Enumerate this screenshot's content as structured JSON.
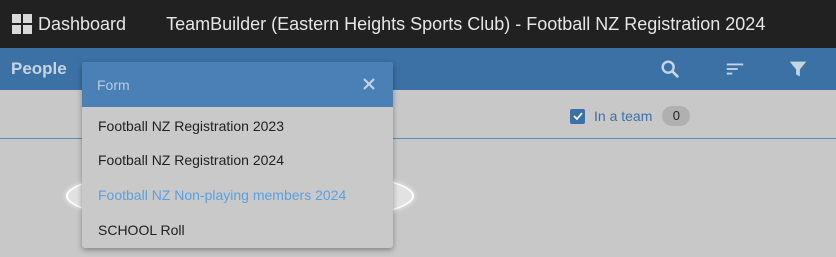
{
  "topbar": {
    "dashboard_label": "Dashboard",
    "app_title": "TeamBuilder (Eastern Heights Sports Club) - Football NZ Registration 2024"
  },
  "toolbar": {
    "section_label": "People",
    "icons": [
      "search-icon",
      "sort-icon",
      "filter-icon"
    ]
  },
  "filters": {
    "in_team_label": "In a team",
    "in_team_checked": true,
    "in_team_count": "0"
  },
  "dropdown": {
    "header_label": "Form",
    "items": [
      {
        "label": "Football NZ Registration 2023"
      },
      {
        "label": "Football NZ Registration 2024"
      },
      {
        "label": "Football NZ Non-playing members 2024",
        "highlighted": true
      },
      {
        "label": "SCHOOL Roll"
      }
    ]
  },
  "colors": {
    "topbar": "#212121",
    "toolbar": "#3c71a5",
    "highlight_text": "#5a9fe0",
    "background": "#c8c8c8"
  }
}
